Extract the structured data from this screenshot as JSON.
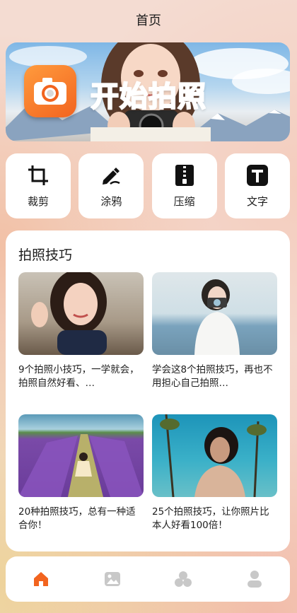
{
  "header": {
    "title": "首页"
  },
  "banner": {
    "title": "开始拍照",
    "icon": "camera-icon",
    "accent": "#f2641f"
  },
  "tools": [
    {
      "id": "crop",
      "label": "裁剪",
      "icon": "crop-icon"
    },
    {
      "id": "doodle",
      "label": "涂鸦",
      "icon": "pen-icon"
    },
    {
      "id": "compress",
      "label": "压缩",
      "icon": "zip-icon"
    },
    {
      "id": "text",
      "label": "文字",
      "icon": "text-icon"
    }
  ],
  "tips": {
    "title": "拍照技巧",
    "articles": [
      {
        "caption": "9个拍照小技巧，一学就会，拍照自然好看、…"
      },
      {
        "caption": "学会这8个拍照技巧，再也不用担心自己拍照…"
      },
      {
        "caption": "20种拍照技巧，总有一种适合你！"
      },
      {
        "caption": "25个拍照技巧，让你照片比本人好看100倍！"
      }
    ]
  },
  "bottom_nav": [
    {
      "id": "home",
      "icon": "home-icon",
      "active": true
    },
    {
      "id": "gallery",
      "icon": "image-icon",
      "active": false
    },
    {
      "id": "discover",
      "icon": "circles-icon",
      "active": false
    },
    {
      "id": "profile",
      "icon": "person-icon",
      "active": false
    }
  ],
  "colors": {
    "active": "#f2641f",
    "inactive": "#c8c8c8"
  }
}
